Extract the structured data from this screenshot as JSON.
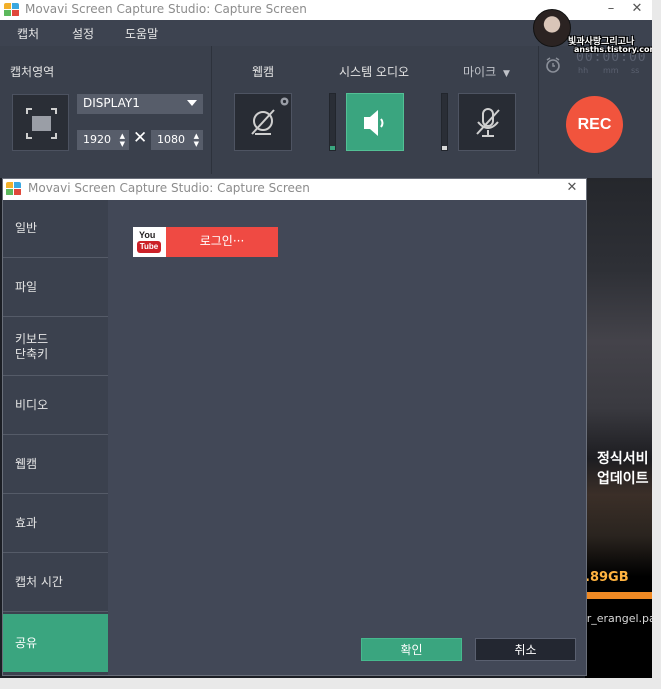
{
  "main_window": {
    "title": "Movavi Screen Capture Studio: Capture Screen",
    "minimize_label": "–",
    "close_label": "✕",
    "menu": [
      "캡처",
      "설정",
      "도움말"
    ],
    "capture_area": {
      "label": "캡처영역",
      "display_value": "DISPLAY1",
      "width_value": "1920",
      "height_value": "1080",
      "times_symbol": "✕"
    },
    "webcam_label": "웹캠",
    "system_audio_label": "시스템 오디오",
    "mic_label": "마이크",
    "rec_label": "REC",
    "timer": {
      "digits": "00:00:00",
      "units": [
        "hh",
        "mm",
        "ss"
      ]
    },
    "watermark": {
      "line1": "빛과사랑그리고나",
      "line2": "ansths.tistory.com"
    },
    "level_colors": {
      "system_audio": "#3aa57f",
      "mic": "#d7d7d7"
    }
  },
  "background": {
    "line1": "정식서비",
    "line2": "업데이트",
    "size_text": ".89GB",
    "file_text": "or_erangel.pa"
  },
  "dialog": {
    "title": "Movavi Screen Capture Studio: Capture Screen",
    "close_label": "✕",
    "nav": [
      {
        "label": "일반",
        "active": false
      },
      {
        "label": "파일",
        "active": false
      },
      {
        "label": "키보드\n단축키",
        "active": false
      },
      {
        "label": "비디오",
        "active": false
      },
      {
        "label": "웹캠",
        "active": false
      },
      {
        "label": "효과",
        "active": false
      },
      {
        "label": "캡처 시간",
        "active": false
      },
      {
        "label": "공유",
        "active": true
      }
    ],
    "youtube": {
      "logo_top": "You",
      "logo_bottom": "Tube",
      "login_label": "로그인···"
    },
    "ok_label": "확인",
    "cancel_label": "취소"
  },
  "colors": {
    "accent_green": "#3aa57f",
    "rec_red": "#f1543d",
    "youtube_red": "#ef4a43",
    "panel_bg": "#3d4350"
  }
}
